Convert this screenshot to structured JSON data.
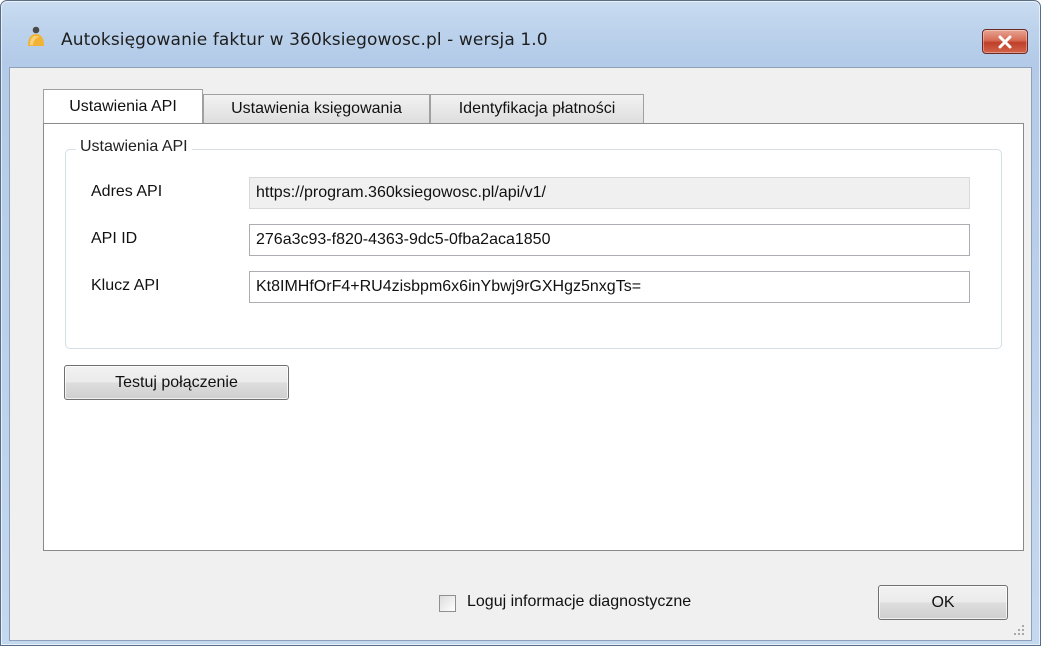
{
  "window": {
    "title": "Autoksięgowanie faktur w 360ksiegowosc.pl - wersja 1.0",
    "icon": "app-person-icon",
    "close_icon": "close-icon",
    "close_color": "#c7432b"
  },
  "tabs": [
    {
      "label": "Ustawienia API",
      "active": true
    },
    {
      "label": "Ustawienia księgowania",
      "active": false
    },
    {
      "label": "Identyfikacja płatności",
      "active": false
    }
  ],
  "api_settings": {
    "group_title": "Ustawienia API",
    "address_label": "Adres API",
    "address_value": "https://program.360ksiegowosc.pl/api/v1/",
    "id_label": "API ID",
    "id_value": "276a3c93-f820-4363-9dc5-0fba2aca1850",
    "key_label": "Klucz API",
    "key_value": "Kt8IMHfOrF4+RU4zisbpm6x6inYbwj9rGXHgz5nxgTs="
  },
  "test_button": {
    "label": "Testuj połączenie"
  },
  "footer": {
    "log_checkbox_label": "Loguj informacje diagnostyczne",
    "log_checked": false,
    "ok_label": "OK"
  }
}
